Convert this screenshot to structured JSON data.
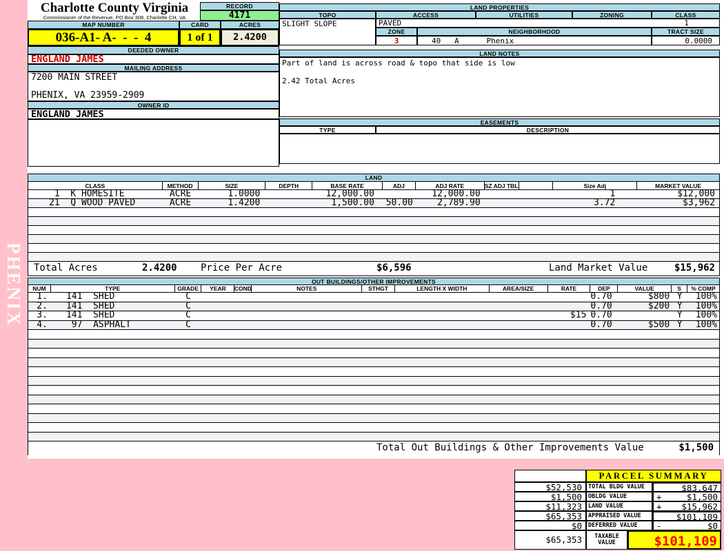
{
  "header": {
    "county": "Charlotte County Virginia",
    "commissioner": "Commissioner of the Revenue, PO Box 308, Charlotte CH, VA",
    "record_label": "RECORD",
    "record_value": "4171",
    "map_number_label": "MAP NUMBER",
    "map_number": "036-A1- A-  -  -  4",
    "card_label": "CARD",
    "card": "1 of 1",
    "acres_label": "ACRES",
    "acres": "2.4200"
  },
  "owner": {
    "deeded_owner_label": "DEEDED OWNER",
    "deeded_owner": "ENGLAND JAMES",
    "mailing_address_label": "MAILING ADDRESS",
    "address_line1": "7200 MAIN STREET",
    "address_line2": "PHENIX, VA 23959-2909",
    "owner_id_label": "OWNER ID",
    "owner_id": "ENGLAND JAMES"
  },
  "land_properties": {
    "title": "LAND PROPERTIES",
    "topo_label": "TOPO",
    "topo": "SLIGHT SLOPE",
    "access_label": "ACCESS",
    "access": "PAVED",
    "utilities_label": "UTILITIES",
    "zoning_label": "ZONING",
    "class_label": "CLASS",
    "class_value": "1",
    "zone_label": "ZONE",
    "zone": "3",
    "neighborhood_label": "NEIGHBORHOOD",
    "neighborhood": "40   A      Phenix",
    "tract_size_label": "TRACT SIZE",
    "tract_size": "0.0000"
  },
  "land_notes": {
    "title": "LAND NOTES",
    "line1": "Part of land is across road & topo that side is low",
    "line2": "2.42 Total Acres"
  },
  "easements": {
    "title": "EASEMENTS",
    "type_label": "TYPE",
    "description_label": "DESCRIPTION"
  },
  "land": {
    "title": "LAND",
    "headers": [
      "CLASS",
      "METHOD",
      "SIZE",
      "DEPTH",
      "BASE RATE",
      "ADJ",
      "ADJ RATE",
      "SZ ADJ TBL",
      "",
      "Size Adj",
      "MARKET VALUE"
    ],
    "rows": [
      {
        "class": " 1  K HOMESITE",
        "method": "ACRE",
        "size": "1.0000",
        "depth": "",
        "base_rate": "12,000.00",
        "adj": "",
        "adj_rate": "12,000.00",
        "sz_adj_tbl": "",
        "size_adj": "1",
        "market_value": "$12,000"
      },
      {
        "class": "21  Q WOOD PAVED",
        "method": "ACRE",
        "size": "1.4200",
        "depth": "",
        "base_rate": "1,500.00",
        "adj": "50.00",
        "adj_rate": "2,789.90",
        "sz_adj_tbl": "",
        "size_adj": "3.72",
        "market_value": "$3,962"
      }
    ],
    "total_acres_label": "Total Acres",
    "total_acres": "2.4200",
    "price_per_acre_label": "Price Per Acre",
    "price_per_acre": "$6,596",
    "land_market_value_label": "Land Market Value",
    "land_market_value": "$15,962"
  },
  "out_buildings": {
    "title": "OUT BUILDINGS/OTHER IMPROVEMENTS",
    "headers": [
      "NUM",
      "TYPE",
      "GRADE",
      "YEAR",
      "COND",
      "NOTES",
      "STHGT",
      "LENGTH X WIDTH",
      "AREA/SIZE",
      "RATE",
      "DEP",
      "VALUE",
      "S",
      "% COMP"
    ],
    "rows": [
      {
        "num": "1.",
        "type": "141  SHED",
        "grade": "C",
        "rate": "",
        "dep": "0.70",
        "value": "$800",
        "s": "Y",
        "comp": "100%"
      },
      {
        "num": "2.",
        "type": "141  SHED",
        "grade": "C",
        "rate": "",
        "dep": "0.70",
        "value": "$200",
        "s": "Y",
        "comp": "100%"
      },
      {
        "num": "3.",
        "type": "141  SHED",
        "grade": "C",
        "rate": "$15",
        "dep": "0.70",
        "value": "",
        "s": "Y",
        "comp": "100%"
      },
      {
        "num": "4.",
        "type": " 97  ASPHALT",
        "grade": "C",
        "rate": "",
        "dep": "0.70",
        "value": "$500",
        "s": "Y",
        "comp": "100%"
      }
    ],
    "total_label": "Total Out Buildings & Other Improvements Value",
    "total_value": "$1,500"
  },
  "parcel_summary": {
    "title": "PARCEL SUMMARY",
    "rows": [
      {
        "left": "$52,530",
        "label": "TOTAL BLDG VALUE",
        "op": "",
        "right": "$83,647"
      },
      {
        "left": "$1,500",
        "label": "OBLDG VALUE",
        "op": "+",
        "right": "$1,500"
      },
      {
        "left": "$11,323",
        "label": "LAND VALUE",
        "op": "+",
        "right": "$15,962"
      },
      {
        "left": "$65,353",
        "label": "APPRAISED VALUE",
        "op": "",
        "right": "$101,109"
      },
      {
        "left": "$0",
        "label": "DEFERRED VALUE",
        "op": "-",
        "right": "$0"
      }
    ],
    "taxable": {
      "left": "$65,353",
      "label": "TAXABLE VALUE",
      "value": "$101,109"
    }
  },
  "watermark": "PHENIX",
  "colors": {
    "page_pink": "#FFC0CB",
    "header_blue": "#ADD8E6",
    "record_green": "#90EE90",
    "highlight_yellow": "#FFFF00",
    "acres_cream": "#F0EEDC",
    "owner_red": "#CC0000",
    "taxable_red": "#FF0000",
    "alt_row": "#F2F2F8"
  }
}
